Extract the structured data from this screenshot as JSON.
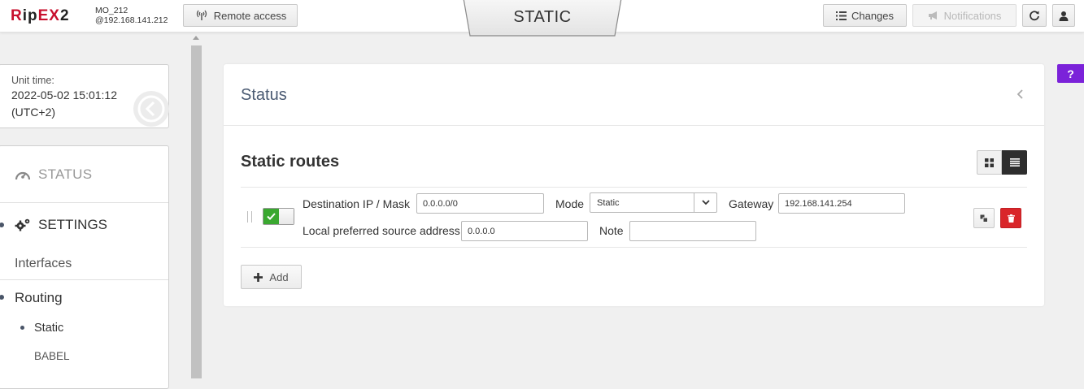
{
  "header": {
    "logo": "RipEX2",
    "unit_name": "MO_212",
    "unit_address": "@192.168.141.212",
    "remote_access_label": "Remote access",
    "page_tab": "STATIC",
    "changes_label": "Changes",
    "notifications_label": "Notifications",
    "icons": [
      "antenna-icon",
      "list-icon",
      "megaphone-icon",
      "refresh-icon",
      "user-icon"
    ]
  },
  "unit_time": {
    "label": "Unit time:",
    "datetime": "2022-05-02 15:01:12",
    "timezone": "(UTC+2)"
  },
  "nav": {
    "status_label": "STATUS",
    "settings_label": "SETTINGS",
    "interfaces_label": "Interfaces",
    "routing_label": "Routing",
    "static_label": "Static",
    "babel_label": "BABEL"
  },
  "main": {
    "card_title": "Status",
    "section_title": "Static routes",
    "route": {
      "enabled": true,
      "dest_label": "Destination IP / Mask",
      "dest_value": "0.0.0.0/0",
      "mode_label": "Mode",
      "mode_value": "Static",
      "gateway_label": "Gateway",
      "gateway_value": "192.168.141.254",
      "src_label": "Local preferred source address",
      "src_value": "0.0.0.0",
      "note_label": "Note",
      "note_value": ""
    },
    "add_label": "Add"
  },
  "help_label": "?",
  "colors": {
    "brand_red": "#c8102e",
    "toggle_green": "#3aa830",
    "delete_red": "#d9262a",
    "help_purple": "#7b22d9",
    "title_blue": "#4a5a72"
  }
}
